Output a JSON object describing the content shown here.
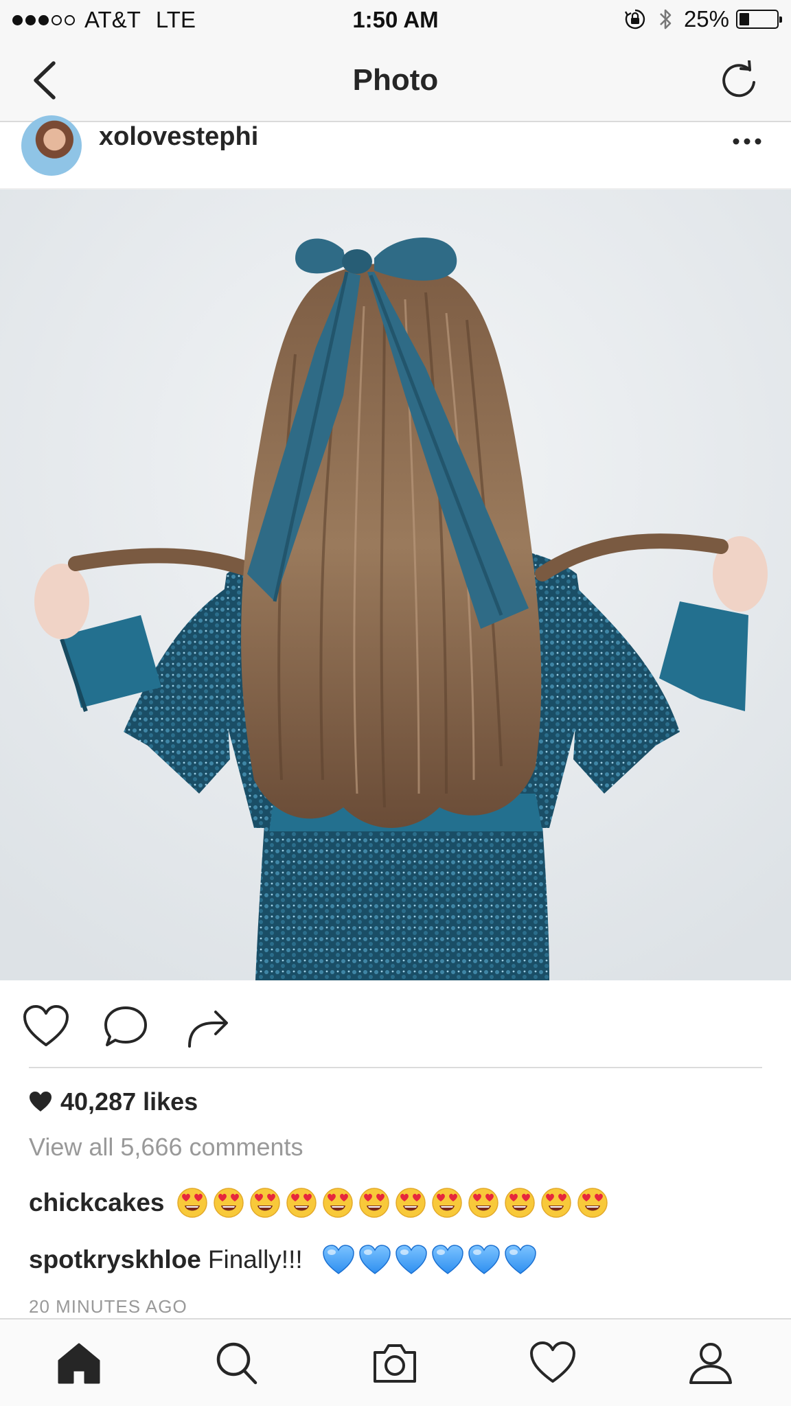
{
  "status_bar": {
    "signal_dots_filled": 3,
    "signal_dots_total": 5,
    "carrier": "AT&T",
    "network": "LTE",
    "time": "1:50 AM",
    "battery_text": "25%",
    "battery_level": 0.25,
    "icons": [
      "orientation-lock-icon",
      "bluetooth-icon",
      "battery-icon"
    ]
  },
  "nav": {
    "title": "Photo",
    "back_icon": "chevron-left-icon",
    "refresh_icon": "refresh-icon"
  },
  "post": {
    "username": "xolovestephi",
    "more_icon": "ellipsis-icon",
    "likes": "40,287 likes",
    "view_all": "View all 5,666 comments",
    "comments": [
      {
        "author": "chickcakes",
        "text": "",
        "emoji": "heart-eyes-emoji",
        "emoji_count": 12
      },
      {
        "author": "spotkryskhloe",
        "text": "Finally!!!",
        "emoji": "blue-heart-emoji",
        "emoji_count": 6
      }
    ],
    "timestamp": "20 MINUTES AGO"
  },
  "actions": [
    "like-icon",
    "comment-icon",
    "share-icon"
  ],
  "tabs": [
    "home-icon",
    "search-icon",
    "camera-icon",
    "activity-heart-icon",
    "profile-icon"
  ],
  "colors": {
    "bow": "#2f6b86",
    "dress": "#1f5a74",
    "hair": "#8a6a4f",
    "blue_heart": "#2e8ff0",
    "emoji_face": "#f8c93a",
    "emoji_heart": "#e6273d"
  }
}
